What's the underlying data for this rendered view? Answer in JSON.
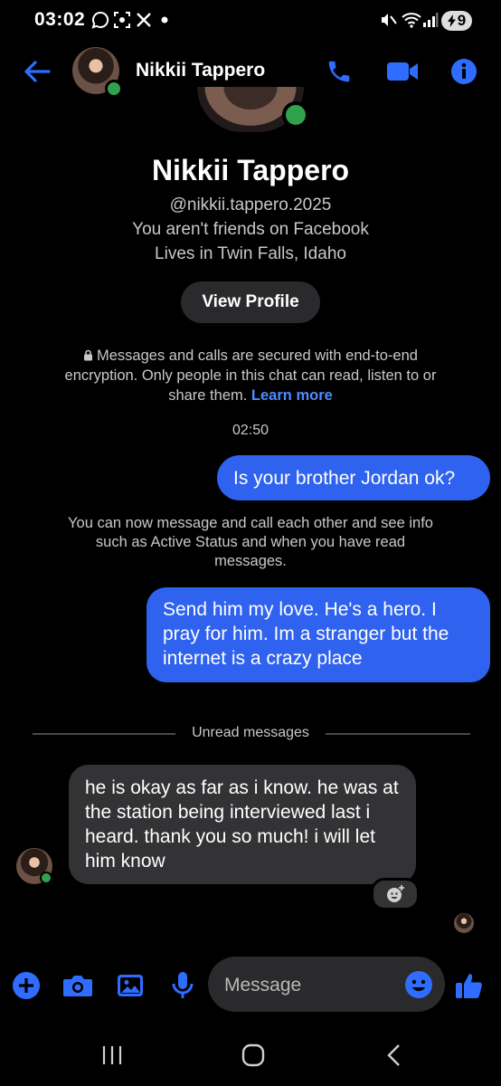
{
  "status_bar": {
    "time": "03:02",
    "battery": "9"
  },
  "header": {
    "contact_name": "Nikkii Tappero"
  },
  "profile": {
    "name": "Nikkii Tappero",
    "username": "@nikkii.tappero.2025",
    "friend_status": "You aren't friends on Facebook",
    "location": "Lives in Twin Falls, Idaho",
    "view_profile_label": "View Profile"
  },
  "encryption": {
    "text": "Messages and calls are secured with end-to-end encryption. Only people in this chat can read, listen to or share them.",
    "learn_more": "Learn more"
  },
  "conversation": {
    "timestamp": "02:50",
    "messages": [
      {
        "direction": "outgoing",
        "text": "Is your brother Jordan ok?"
      },
      {
        "direction": "system",
        "text": "You can now message and call each other and see info such as Active Status and when you have read messages."
      },
      {
        "direction": "outgoing",
        "text": "Send him my love. He's a hero. I pray for him. Im a stranger but the internet is a crazy place"
      },
      {
        "direction": "incoming",
        "text": "he is okay as far as i know. he was at the station being interviewed last i heard. thank you so much! i will let him know"
      }
    ],
    "unread_label": "Unread messages"
  },
  "composer": {
    "placeholder": "Message"
  },
  "colors": {
    "accent": "#2e62ef",
    "link": "#4f8cff",
    "online": "#31a24c",
    "incoming_bubble": "#333335"
  }
}
